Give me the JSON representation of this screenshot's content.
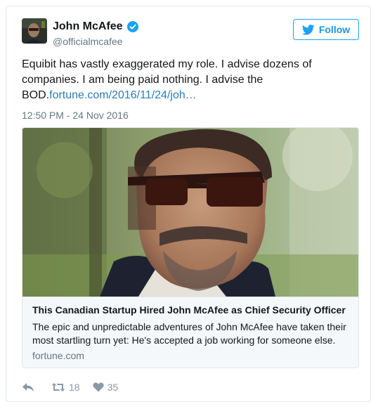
{
  "user": {
    "display_name": "John McAfee",
    "handle": "@officialmcafee",
    "verified": true
  },
  "follow_button": {
    "label": "Follow",
    "color": "#1da1f2"
  },
  "tweet": {
    "text": "Equibit has vastly exaggerated my role. I advise dozens of companies. I am being paid nothing. I advise the BOD.",
    "link": "fortune.com/2016/11/24/joh…",
    "timestamp": "12:50 PM - 24 Nov 2016"
  },
  "card": {
    "title": "This Canadian Startup Hired John McAfee as Chief Security Officer",
    "description": "The epic and unpredictable adventures of John McAfee have taken their most startling turn yet: He's accepted a job working for someone else.",
    "domain": "fortune.com"
  },
  "actions": {
    "reply_icon": "reply-icon",
    "retweet_icon": "retweet-icon",
    "retweet_count": "18",
    "like_icon": "heart-icon",
    "like_count": "35"
  },
  "colors": {
    "link": "#2b7bb9",
    "muted": "#657786",
    "icon": "#8899a6",
    "border": "#e1e8ed"
  }
}
